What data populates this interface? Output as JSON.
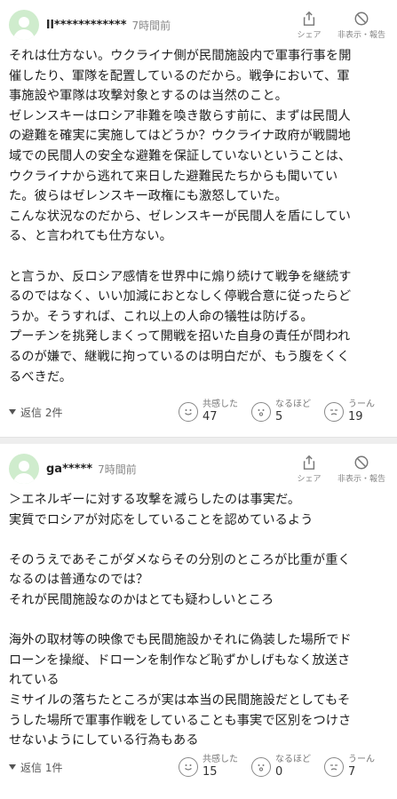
{
  "comments": [
    {
      "author": "ll************",
      "time": "7時間前",
      "share_label": "シェア",
      "hide_label": "非表示・報告",
      "body": "それは仕方ない。ウクライナ側が民間施設内で軍事行事を開\n催したり、軍隊を配置しているのだから。戦争において、軍\n事施設や軍隊は攻撃対象とするのは当然のこと。\nゼレンスキーはロシア非難を喚き散らす前に、まずは民間人\nの避難を確実に実施してはどうか？ウクライナ政府が戦闘地\n域での民間人の安全な避難を保証していないということは、\nウクライナから逃れて来日した避難民たちからも聞いてい\nた。彼らはゼレンスキー政権にも激怒していた。\nこんな状況なのだから、ゼレンスキーが民間人を盾にしてい\nる、と言われても仕方ない。\n\nと言うか、反ロシア感情を世界中に煽り続けて戦争を継続す\nるのではなく、いい加減におとなしく停戦合意に従ったらど\nうか。そうすれば、これ以上の人命の犠牲は防げる。\nプーチンを挑発しまくって開戦を招いた自身の責任が問われ\nるのが嫌で、継戦に拘っているのは明白だが、もう腹をくく\nるべきだ。",
      "replies": "返信 2件",
      "reactions": [
        {
          "label": "共感した",
          "count": "47",
          "icon": "empathy-icon"
        },
        {
          "label": "なるほど",
          "count": "5",
          "icon": "insight-icon"
        },
        {
          "label": "うーん",
          "count": "19",
          "icon": "hmm-icon"
        }
      ]
    },
    {
      "author": "ga*****",
      "time": "7時間前",
      "share_label": "シェア",
      "hide_label": "非表示・報告",
      "body": "＞エネルギーに対する攻撃を減らしたのは事実だ。\n実質でロシアが対応をしていることを認めているよう\n\nそのうえであそこがダメならその分別のところが比重が重く\nなるのは普通なのでは？\nそれが民間施設なのかはとても疑わしいところ\n\n海外の取材等の映像でも民間施設かそれに偽装した場所でド\nローンを操縦、ドローンを制作など恥ずかしげもなく放送さ\nれている\nミサイルの落ちたところが実は本当の民間施設だとしてもそ\nうした場所で軍事作戦をしていることも事実で区別をつけさ\nせないようにしている行為もある",
      "replies": "返信 1件",
      "reactions": [
        {
          "label": "共感した",
          "count": "15",
          "icon": "empathy-icon"
        },
        {
          "label": "なるほど",
          "count": "0",
          "icon": "insight-icon"
        },
        {
          "label": "うーん",
          "count": "7",
          "icon": "hmm-icon"
        }
      ]
    }
  ]
}
